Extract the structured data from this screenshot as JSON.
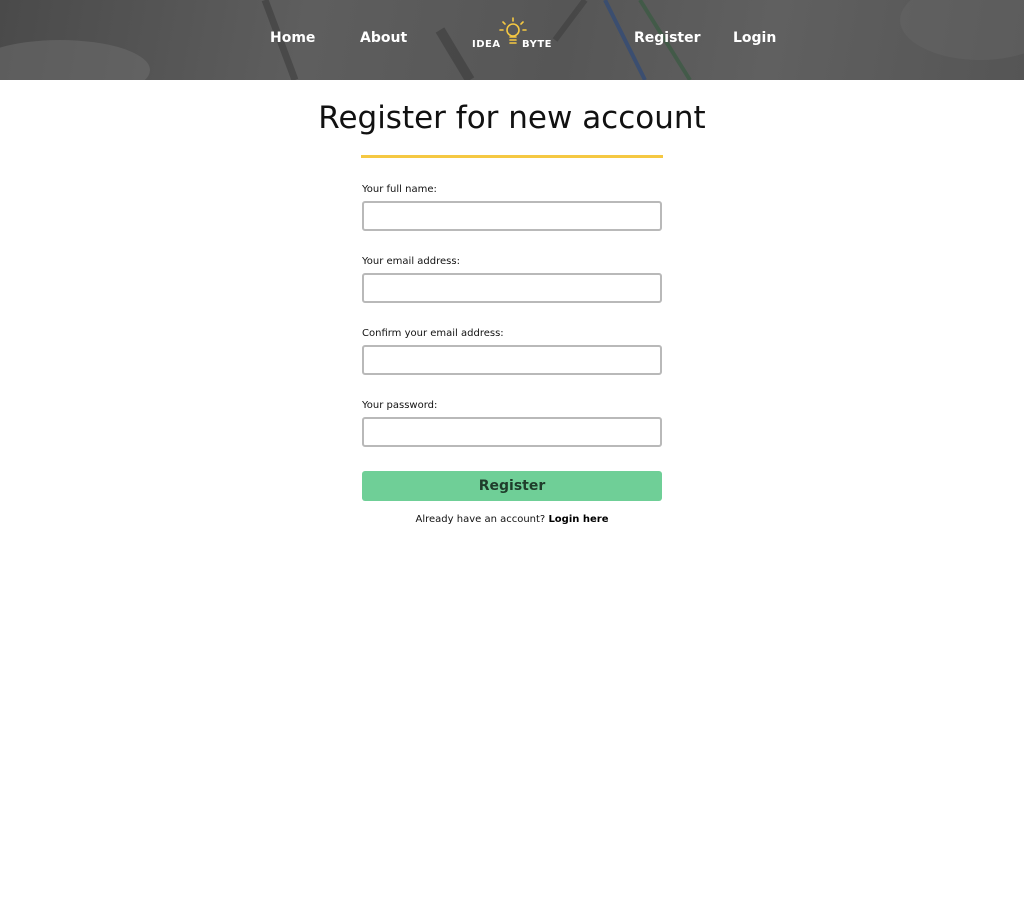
{
  "nav": {
    "home_label": "Home",
    "about_label": "About",
    "register_label": "Register",
    "login_label": "Login",
    "logo": {
      "text_left": "IDEA",
      "text_right": "BYTE",
      "bulb_color": "#f5c842"
    }
  },
  "page": {
    "title": "Register for new account",
    "accent_color": "#f5c842"
  },
  "form": {
    "fields": [
      {
        "label": "Your full name:",
        "value": ""
      },
      {
        "label": "Your email address:",
        "value": ""
      },
      {
        "label": "Confirm your email address:",
        "value": ""
      },
      {
        "label": "Your password:",
        "value": ""
      }
    ],
    "submit_label": "Register",
    "submit_color": "#6fcf97",
    "login_prompt": "Already have an account?",
    "login_link": "Login here"
  }
}
